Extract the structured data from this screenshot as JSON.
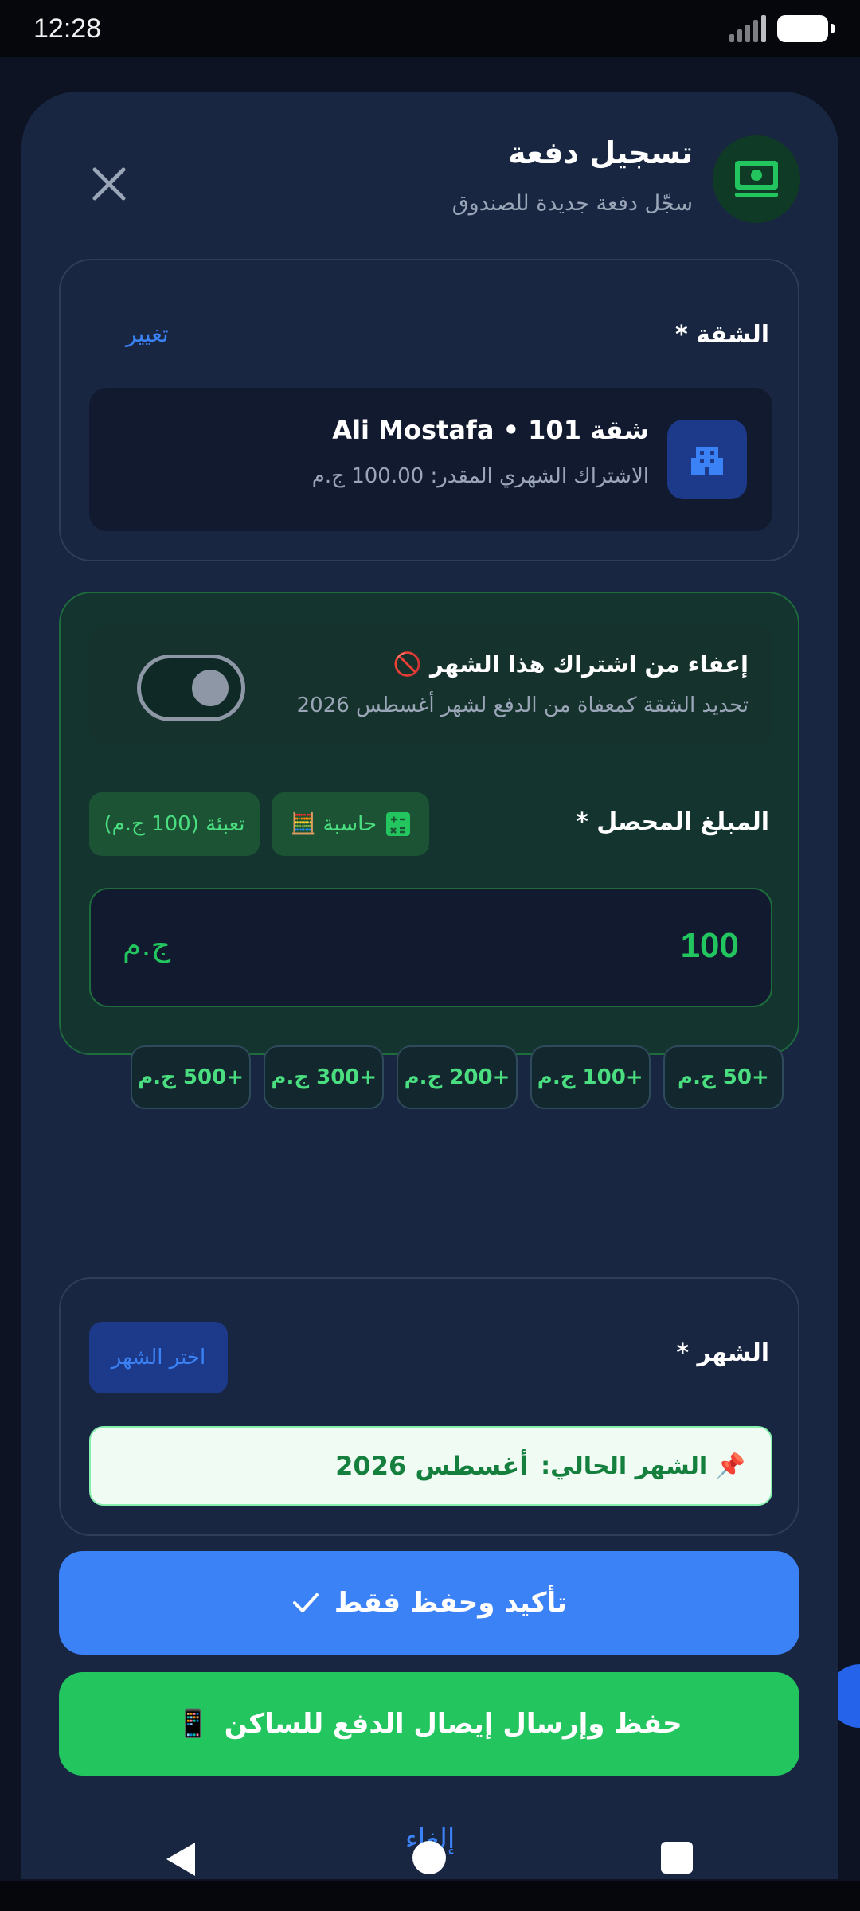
{
  "status_bar": {
    "time": "12:28"
  },
  "header": {
    "title": "تسجيل دفعة",
    "subtitle": "سجّل دفعة جديدة للصندوق"
  },
  "apartment": {
    "label": "الشقة *",
    "change_label": "تغيير",
    "title": "شقة 101 • Ali Mostafa",
    "subtitle": "الاشتراك الشهري المقدر: 100.00 ج.م"
  },
  "exemption": {
    "title": "إعفاء من اشتراك هذا الشهر 🚫",
    "subtitle": "تحديد الشقة كمعفاة من الدفع لشهر أغسطس 2026",
    "enabled": false
  },
  "amount": {
    "label": "المبلغ المحصل *",
    "calculator_label": "حاسبة 🧮",
    "fill_label": "تعبئة (100 ج.م)",
    "value": "100",
    "currency": "ج.م",
    "quick_buttons": [
      "+50 ج.م",
      "+100 ج.م",
      "+200 ج.م",
      "+300 ج.م",
      "+500 ج.م"
    ]
  },
  "month": {
    "label": "الشهر *",
    "pick_label": "اختر الشهر",
    "current_label": "📌 الشهر الحالي:",
    "current_value": "أغسطس 2026"
  },
  "actions": {
    "confirm_label": "تأكيد وحفظ فقط",
    "send_label": "حفظ وإرسال إيصال الدفع للساكن",
    "send_icon": "📱",
    "cancel_label": "إلغاء"
  },
  "colors": {
    "primary": "#3b82f6",
    "success": "#22c55e",
    "sheet_bg": "#182642",
    "page_bg": "#05070d"
  }
}
